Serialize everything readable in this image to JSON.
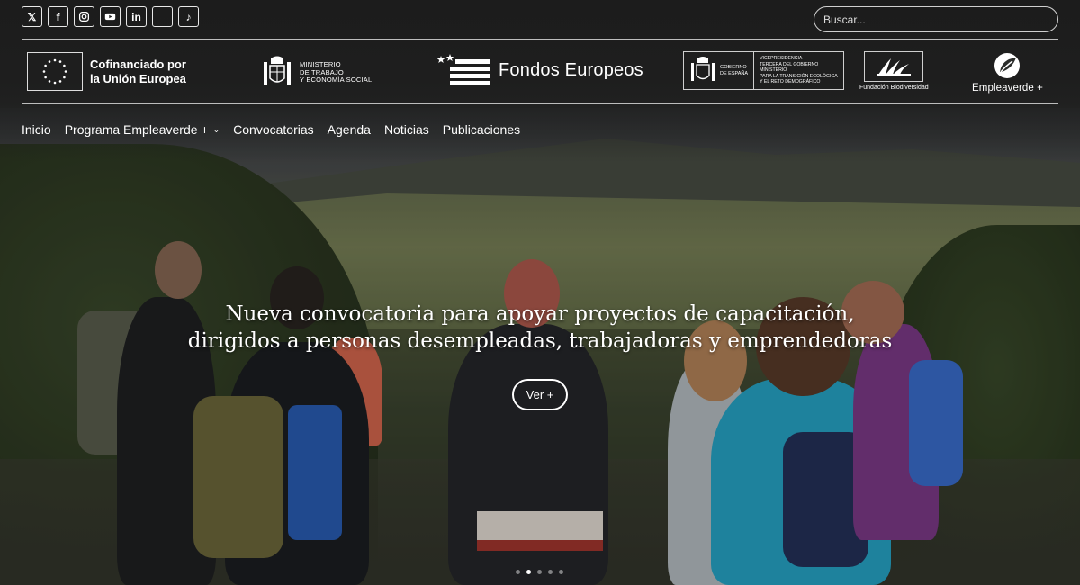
{
  "social": [
    {
      "icon": "x-icon",
      "glyph": "𝕏"
    },
    {
      "icon": "facebook-icon",
      "glyph": "f"
    },
    {
      "icon": "instagram-icon",
      "glyph": ""
    },
    {
      "icon": "youtube-icon",
      "glyph": ""
    },
    {
      "icon": "linkedin-icon",
      "glyph": "in"
    },
    {
      "icon": "blank-icon",
      "glyph": ""
    },
    {
      "icon": "tiktok-icon",
      "glyph": "♪"
    }
  ],
  "search": {
    "placeholder": "Buscar..."
  },
  "logos": {
    "eu": {
      "line1": "Cofinanciado por",
      "line2": "la Unión Europea"
    },
    "ministerio": {
      "line1": "MINISTERIO",
      "line2": "DE TRABAJO",
      "line3": "Y ECONOMÍA SOCIAL"
    },
    "fondos": {
      "text": "Fondos Europeos"
    },
    "gobierno": {
      "line1": "GOBIERNO",
      "line2": "DE ESPAÑA",
      "b1": "VICEPRESIDENCIA",
      "b2": "TERCERA DEL GOBIERNO",
      "b3": "MINISTERIO",
      "b4": "PARA LA TRANSICIÓN ECOLÓGICA",
      "b5": "Y EL RETO DEMOGRÁFICO"
    },
    "biodiversidad": {
      "text": "Fundación Biodiversidad"
    },
    "empleaverde": {
      "text": "Empleaverde +"
    }
  },
  "nav": {
    "inicio": "Inicio",
    "programa": "Programa Empleaverde +",
    "programa_chevron": "⌄",
    "convocatorias": "Convocatorias",
    "agenda": "Agenda",
    "noticias": "Noticias",
    "publicaciones": "Publicaciones"
  },
  "hero": {
    "line1": "Nueva convocatoria para apoyar proyectos de capacitación,",
    "line2": "dirigidos a personas desempleadas, trabajadoras y emprendedoras",
    "button": "Ver +"
  },
  "slider": {
    "total": 5,
    "active_index": 1
  }
}
